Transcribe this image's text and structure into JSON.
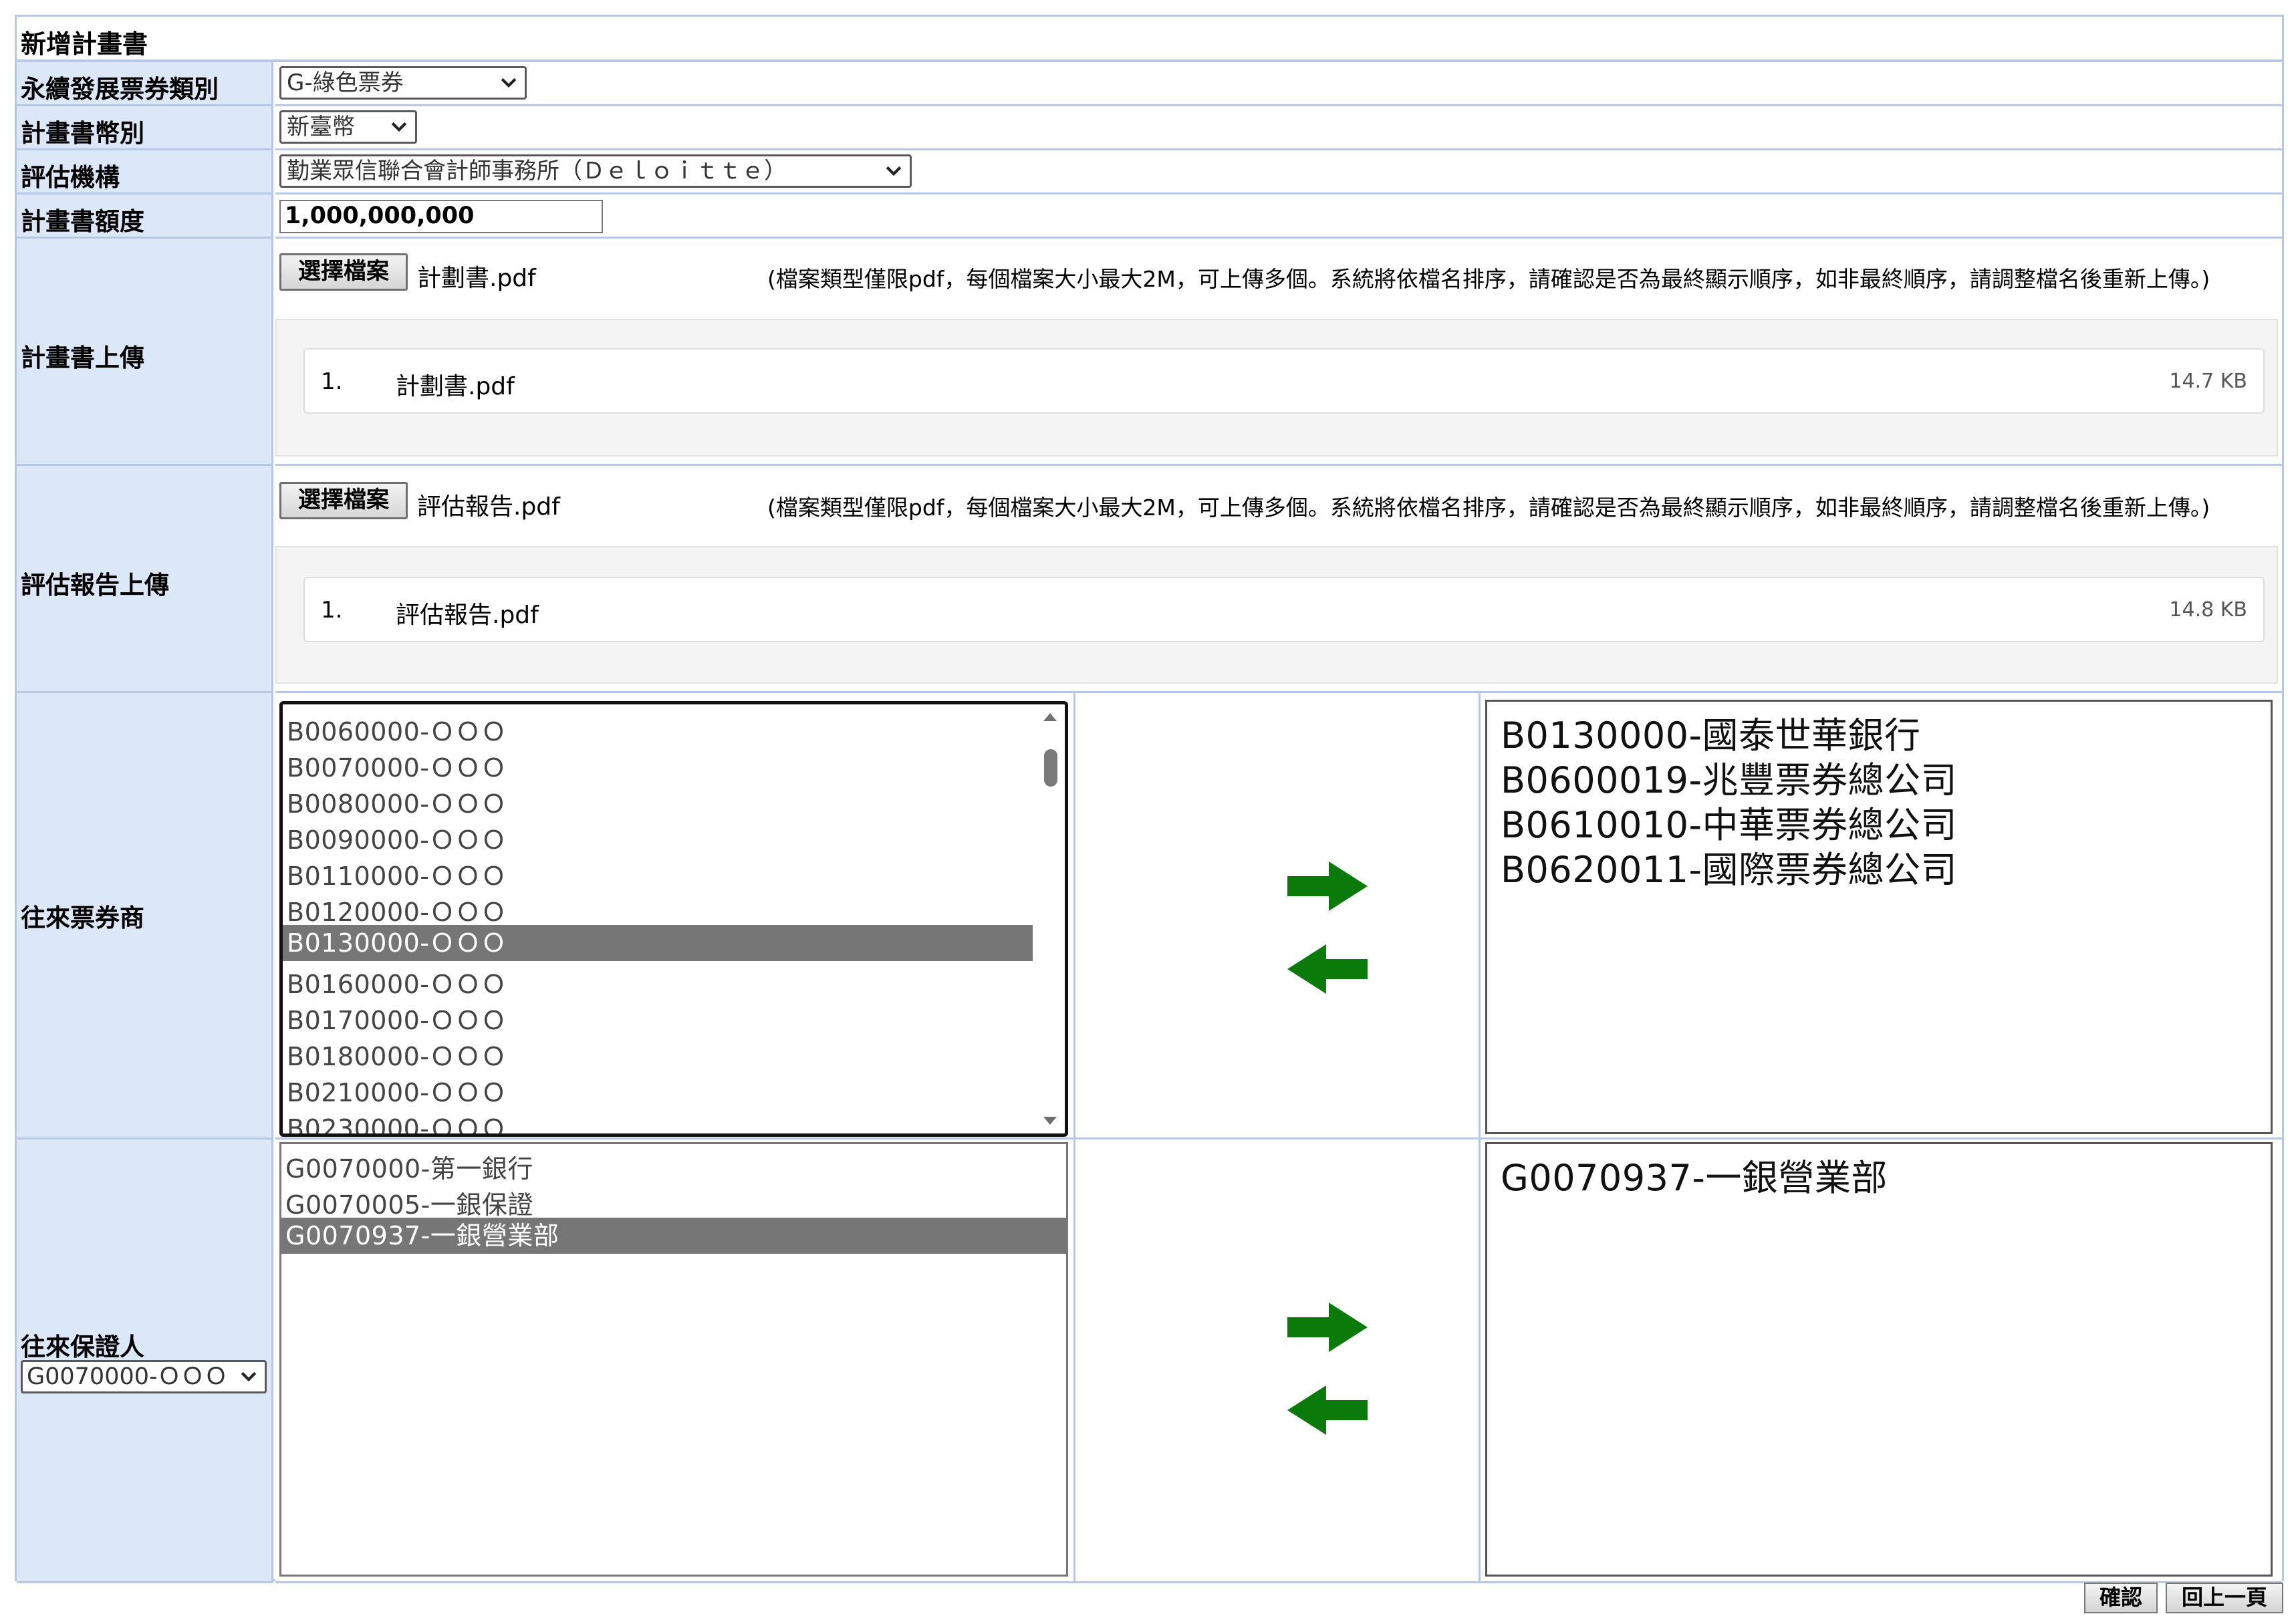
{
  "form_title": "新增計畫書",
  "fields": {
    "ticket_category": {
      "label": "永續發展票券類別",
      "value": "G-綠色票券"
    },
    "currency": {
      "label": "計畫書幣別",
      "value": "新臺幣"
    },
    "evaluator": {
      "label": "評估機構",
      "value": "勤業眾信聯合會計師事務所（Ｄｅｌｏｉｔｔｅ）"
    },
    "amount": {
      "label": "計畫書額度",
      "value": "1,000,000,000"
    }
  },
  "plan_upload": {
    "label": "計畫書上傳",
    "button": "選擇檔案",
    "chosen_file": "計劃書.pdf",
    "hint": "(檔案類型僅限pdf，每個檔案大小最大2M，可上傳多個。系統將依檔名排序，請確認是否為最終顯示順序，如非最終順序，請調整檔名後重新上傳。)",
    "files": [
      {
        "index": "1.",
        "name": "計劃書.pdf",
        "size": "14.7 KB"
      }
    ]
  },
  "report_upload": {
    "label": "評估報告上傳",
    "button": "選擇檔案",
    "chosen_file": "評估報告.pdf",
    "hint": "(檔案類型僅限pdf，每個檔案大小最大2M，可上傳多個。系統將依檔名排序，請確認是否為最終顯示順序，如非最終順序，請調整檔名後重新上傳。)",
    "files": [
      {
        "index": "1.",
        "name": "評估報告.pdf",
        "size": "14.8 KB"
      }
    ]
  },
  "dealers": {
    "label": "往來票券商",
    "available": [
      "B0060000-ＯＯＯ",
      "B0070000-ＯＯＯ",
      "B0080000-ＯＯＯ",
      "B0090000-ＯＯＯ",
      "B0110000-ＯＯＯ",
      "B0120000-ＯＯＯ",
      "B0130000-ＯＯＯ",
      "B0160000-ＯＯＯ",
      "B0170000-ＯＯＯ",
      "B0180000-ＯＯＯ",
      "B0210000-ＯＯＯ",
      "B0230000-ＯＯＯ"
    ],
    "selected_index": 6,
    "chosen": [
      "B0130000-國泰世華銀行",
      "B0600019-兆豐票券總公司",
      "B0610010-中華票券總公司",
      "B0620011-國際票券總公司"
    ]
  },
  "guarantors": {
    "label": "往來保證人",
    "filter_value": "G0070000-ＯＯＯ",
    "available": [
      "G0070000-第一銀行",
      "G0070005-一銀保證",
      "G0070937-一銀營業部"
    ],
    "selected_index": 2,
    "chosen": [
      "G0070937-一銀營業部"
    ]
  },
  "actions": {
    "confirm": "確認",
    "back": "回上一頁"
  },
  "colors": {
    "label_bg": "#dce7f7",
    "border": "#b7c8e6",
    "arrow_green": "#0a7a0a",
    "selected_bg": "#767676"
  }
}
